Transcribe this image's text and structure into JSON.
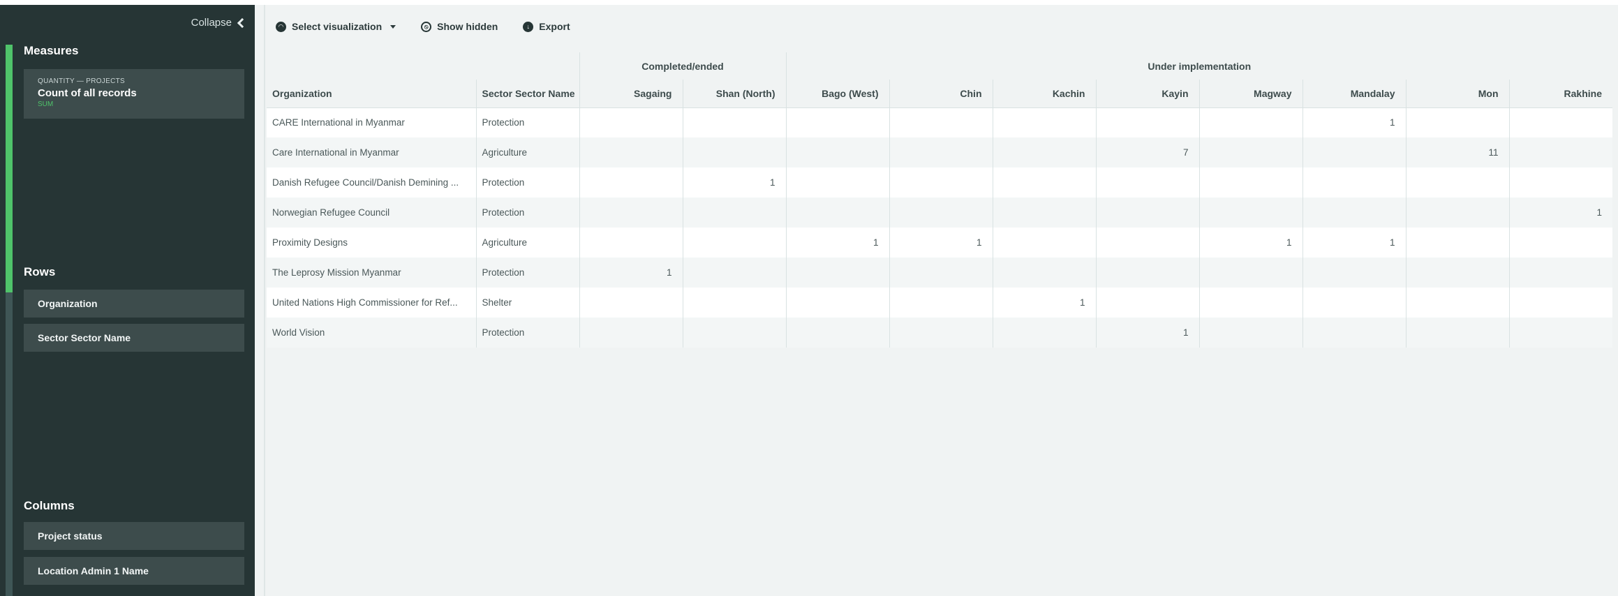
{
  "sidebar": {
    "collapse_label": "Collapse",
    "measures_title": "Measures",
    "measure": {
      "source": "QUANTITY — PROJECTS",
      "name": "Count of all records",
      "aggregation": "SUM"
    },
    "rows_title": "Rows",
    "rows": [
      "Organization",
      "Sector Sector Name"
    ],
    "columns_title": "Columns",
    "columns": [
      "Project status",
      "Location Admin 1 Name"
    ]
  },
  "toolbar": {
    "select_visualization": "Select visualization",
    "show_hidden": "Show hidden",
    "export": "Export"
  },
  "table": {
    "groups": [
      "Completed/ended",
      "Under implementation"
    ],
    "row_headers": [
      "Organization",
      "Sector Sector Name"
    ],
    "columns": [
      "Sagaing",
      "Shan (North)",
      "Bago (West)",
      "Chin",
      "Kachin",
      "Kayin",
      "Magway",
      "Mandalay",
      "Mon",
      "Rakhine"
    ],
    "rows": [
      {
        "org": "CARE International in Myanmar",
        "sector": "Protection",
        "values": [
          "",
          "",
          "",
          "",
          "",
          "",
          "",
          "1",
          "",
          ""
        ]
      },
      {
        "org": "Care International in Myanmar",
        "sector": "Agriculture",
        "values": [
          "",
          "",
          "",
          "",
          "",
          "7",
          "",
          "",
          "11",
          ""
        ]
      },
      {
        "org": "Danish Refugee Council/Danish Demining ...",
        "sector": "Protection",
        "values": [
          "",
          "1",
          "",
          "",
          "",
          "",
          "",
          "",
          "",
          ""
        ]
      },
      {
        "org": "Norwegian Refugee Council",
        "sector": "Protection",
        "values": [
          "",
          "",
          "",
          "",
          "",
          "",
          "",
          "",
          "",
          "1"
        ]
      },
      {
        "org": "Proximity Designs",
        "sector": "Agriculture",
        "values": [
          "",
          "",
          "1",
          "1",
          "",
          "",
          "1",
          "1",
          "",
          ""
        ]
      },
      {
        "org": "The Leprosy Mission Myanmar",
        "sector": "Protection",
        "values": [
          "1",
          "",
          "",
          "",
          "",
          "",
          "",
          "",
          "",
          ""
        ]
      },
      {
        "org": "United Nations High Commissioner for Ref...",
        "sector": "Shelter",
        "values": [
          "",
          "",
          "",
          "",
          "1",
          "",
          "",
          "",
          "",
          ""
        ]
      },
      {
        "org": "World Vision",
        "sector": "Protection",
        "values": [
          "",
          "",
          "",
          "",
          "",
          "1",
          "",
          "",
          "",
          ""
        ]
      }
    ]
  },
  "colors": {
    "sidebar_bg": "#263535",
    "accent_green": "#4fc36a",
    "pill_bg": "#3d4c4c"
  }
}
